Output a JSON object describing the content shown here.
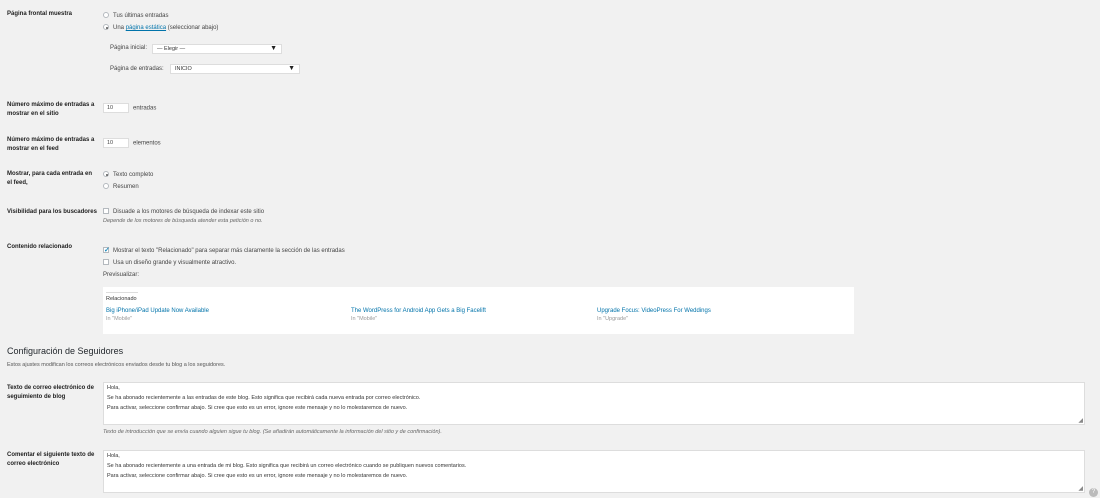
{
  "front_page": {
    "label": "Página frontal muestra",
    "option_latest": "Tus últimas entradas",
    "option_static_prefix": "Una",
    "option_static_link": "página estática",
    "option_static_suffix": "(seleccionar abajo)",
    "home_label": "Página inicial:",
    "home_value": "— Elegir —",
    "posts_label": "Página de entradas:",
    "posts_value": "INICIO"
  },
  "posts_per_page": {
    "label": "Número máximo de entradas a mostrar en el sitio",
    "value": "10",
    "unit": "entradas"
  },
  "posts_per_feed": {
    "label": "Número máximo de entradas a mostrar en el feed",
    "value": "10",
    "unit": "elementos"
  },
  "feed_show": {
    "label": "Mostrar, para cada entrada en el feed,",
    "option_full": "Texto completo",
    "option_summary": "Resumen"
  },
  "visibility": {
    "label": "Visibilidad para los buscadores",
    "checkbox": "Disuade a los motores de búsqueda de indexar este sitio",
    "desc": "Depende de los motores de búsqueda atender esta petición o no."
  },
  "related": {
    "label": "Contenido relacionado",
    "opt_show_header": "Mostrar el texto \"Relacionado\" para separar más claramente la sección de las entradas",
    "opt_large": "Usa un diseño grande y visualmente atractivo.",
    "preview_label": "Previsualizar:",
    "preview_heading": "Relacionado",
    "items": [
      {
        "title": "Big iPhone/iPad Update Now Available",
        "category": "In \"Mobile\""
      },
      {
        "title": "The WordPress for Android App Gets a Big Facelift",
        "category": "In \"Mobile\""
      },
      {
        "title": "Upgrade Focus: VideoPress For Weddings",
        "category": "In \"Upgrade\""
      }
    ]
  },
  "followers": {
    "title": "Configuración de Seguidores",
    "desc": "Estos ajustes modifican los correos electrónicos enviados desde tu blog a los seguidores.",
    "blog_email": {
      "label": "Texto de correo electrónico de seguimiento de blog",
      "lines": [
        "Hola,",
        "Se ha abonado recientemente a las entradas de este blog. Esto significa que recibirá cada nueva entrada por correo electrónico.",
        "Para activar, seleccione confirmar abajo. Si cree que esto es un error, ignore este mensaje y no lo molestaremos de nuevo."
      ],
      "desc": "Texto de introducción que se envía cuando alguien sigue tu blog. (Se añadirán automáticamente la información del sitio y de confirmación)."
    },
    "comment_email": {
      "label": "Comentar el siguiente texto de correo electrónico",
      "lines": [
        "Hola,",
        "Se ha abonado recientemente a una entrada de mi blog. Esto significa que recibirá un correo electrónico cuando se publiquen nuevos comentarios.",
        "Para activar, seleccione confirmar abajo. Si cree que esto es un error, ignore este mensaje y no lo molestaremos de nuevo."
      ]
    }
  },
  "icons": {
    "dropdown": "triangle-down-icon",
    "resize": "resize-grip-icon",
    "corner": "help-icon"
  }
}
